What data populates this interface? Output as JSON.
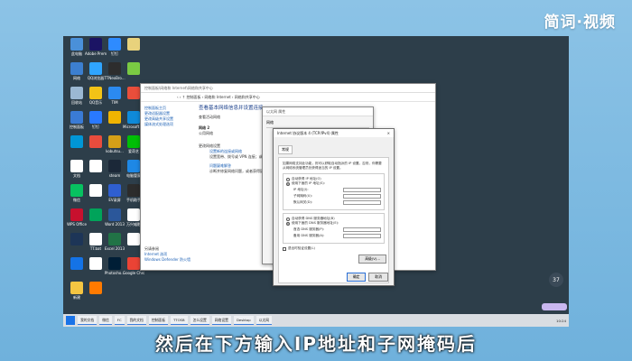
{
  "overlay": {
    "logo": "简词·视频",
    "subtitle": "然后在下方输入IP地址和子网掩码后"
  },
  "desktop": {
    "icons": [
      {
        "label": "此电脑",
        "color": "#4a90d9"
      },
      {
        "label": "Adobe Premi...",
        "color": "#1b1464"
      },
      {
        "label": "钉钉",
        "color": "#2e8bff"
      },
      {
        "label": "",
        "color": "#e8d27c"
      },
      {
        "label": "网络",
        "color": "#3c7fd0"
      },
      {
        "label": "QQ浏览器",
        "color": "#2fa5ff"
      },
      {
        "label": "TTNeoBro...",
        "color": "#2d2d2d"
      },
      {
        "label": "",
        "color": "#7ac943"
      },
      {
        "label": "回收站",
        "color": "#9bb8d3"
      },
      {
        "label": "QQ音乐",
        "color": "#f2c316"
      },
      {
        "label": "TIM",
        "color": "#2b8af0"
      },
      {
        "label": "",
        "color": "#e94e3b"
      },
      {
        "label": "控制面板",
        "color": "#3a7bd5"
      },
      {
        "label": "钉钉",
        "color": "#2979ff"
      },
      {
        "label": "",
        "color": "#f0b400"
      },
      {
        "label": "Microsoft Edge",
        "color": "#0f8ad9"
      },
      {
        "label": "",
        "color": "#0096d6"
      },
      {
        "label": "",
        "color": "#e84c3d"
      },
      {
        "label": "kobutsu...",
        "color": "#d4a017"
      },
      {
        "label": "爱奇艺",
        "color": "#00be06"
      },
      {
        "label": "文档",
        "color": "#ffffff"
      },
      {
        "label": "",
        "color": "#ffffff"
      },
      {
        "label": "steam",
        "color": "#1b2838"
      },
      {
        "label": "电脑管家",
        "color": "#1e88e5"
      },
      {
        "label": "微信",
        "color": "#07c160"
      },
      {
        "label": "",
        "color": "#ffffff"
      },
      {
        "label": "EV录屏",
        "color": "#2f5fd0"
      },
      {
        "label": "手机助手",
        "color": "#2c2c2c"
      },
      {
        "label": "WPS Office",
        "color": "#c8102e"
      },
      {
        "label": "",
        "color": "#00a35a"
      },
      {
        "label": "Word 2013",
        "color": "#2b579a"
      },
      {
        "label": "万兴喵影",
        "color": "#ffffff"
      },
      {
        "label": "",
        "color": "#1d3557"
      },
      {
        "label": "TT.bat",
        "color": "#ffffff"
      },
      {
        "label": "Excel 2013",
        "color": "#217346"
      },
      {
        "label": "",
        "color": "#ffffff"
      },
      {
        "label": "",
        "color": "#1473e6"
      },
      {
        "label": "",
        "color": "#ffffff"
      },
      {
        "label": "Photosho...",
        "color": "#001e36"
      },
      {
        "label": "Google Chrome",
        "color": "#ea4335"
      },
      {
        "label": "新建",
        "color": "#f4c542"
      },
      {
        "label": "",
        "color": "#ff7a00"
      }
    ]
  },
  "control_panel": {
    "title_bar": "控制面板\\网络和 Internet\\网络和共享中心",
    "address": "‹ › ↑  控制面板 › 网络和 Internet › 网络和共享中心",
    "sidebar": [
      "控制面板主页",
      "更改适配器设置",
      "更改高级共享设置",
      "媒体流式处理选项"
    ],
    "heading": "查看基本网络信息并设置连接",
    "section_active": "查看活动网络",
    "network_name": "网络 2",
    "network_type": "公用网络",
    "section_change": "更改网络设置",
    "link1": "设置新的连接或网络",
    "link1_desc": "设置宽带、拨号或 VPN 连接；或设置路由器或接入点。",
    "link2": "问题疑难解答",
    "link2_desc": "诊断并修复网络问题，或者获得疑难解答信息。",
    "see_also": "另请参阅",
    "see1": "Internet 选项",
    "see2": "Windows Defender 防火墙"
  },
  "ethernet_props": {
    "title": "以太网 属性",
    "tab": "网络"
  },
  "ipv4_dialog": {
    "title": "Internet 协议版本 4 (TCP/IPv4) 属性",
    "close": "×",
    "tab": "常规",
    "description": "如果网络支持此功能，则可以获取自动指派的 IP 设置。否则，你需要从网络系统管理员处获得适当的 IP 设置。",
    "auto_ip": "自动获得 IP 地址(O)",
    "manual_ip": "使用下面的 IP 地址(S):",
    "ip_label": "IP 地址(I):",
    "mask_label": "子网掩码(U):",
    "gateway_label": "默认网关(D):",
    "auto_dns": "自动获得 DNS 服务器地址(B)",
    "manual_dns": "使用下面的 DNS 服务器地址(E):",
    "dns1_label": "首选 DNS 服务器(P):",
    "dns2_label": "备用 DNS 服务器(A):",
    "validate": "退出时验证设置(L)",
    "advanced": "高级(V)...",
    "ok": "确定",
    "cancel": "取消"
  },
  "taskbar": {
    "tasks": [
      "我的文档",
      "微信",
      "FC",
      "我的文档",
      "控制面板",
      "TTOSB",
      "怎么设置",
      "网络设置",
      "Desktop",
      "以太网"
    ],
    "clock": "10:24"
  },
  "badge": "37"
}
